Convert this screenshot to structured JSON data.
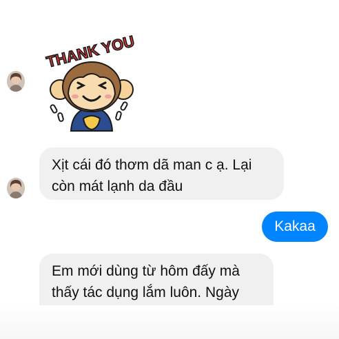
{
  "sticker": {
    "text": "THANK YOU",
    "icon": "monkey-thank-you-sticker"
  },
  "messages": [
    {
      "from": "other",
      "line1": "Xịt cái đó thơm dã man c ạ. Lại",
      "line2": "còn mát lạnh da đầu"
    },
    {
      "from": "me",
      "text": "Kakaa"
    },
    {
      "from": "other",
      "line1": "Em mới dùng từ hôm đấy mà",
      "line2": "thấy tác dụng lắm luôn. Ngày"
    }
  ],
  "colors": {
    "outgoing": "#0084ff",
    "incoming": "#f0f0f0"
  }
}
